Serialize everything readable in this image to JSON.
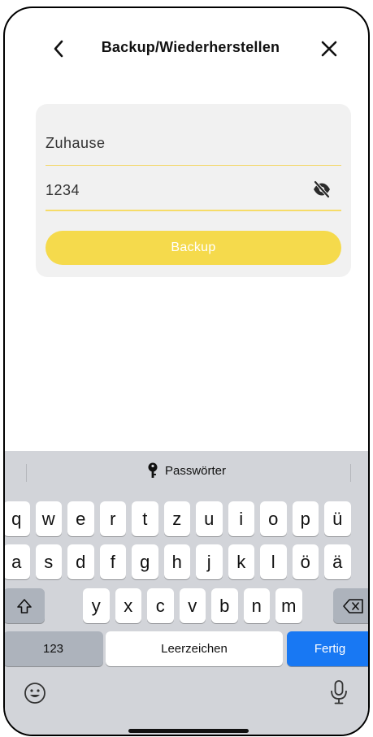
{
  "header": {
    "title": "Backup/Wiederherstellen"
  },
  "form": {
    "name_value": "Zuhause",
    "password_value": "1234",
    "backup_label": "Backup"
  },
  "keyboard": {
    "suggestion": "Passwörter",
    "row1": [
      "q",
      "w",
      "e",
      "r",
      "t",
      "z",
      "u",
      "i",
      "o",
      "p",
      "ü"
    ],
    "row2": [
      "a",
      "s",
      "d",
      "f",
      "g",
      "h",
      "j",
      "k",
      "l",
      "ö",
      "ä"
    ],
    "row3": [
      "y",
      "x",
      "c",
      "v",
      "b",
      "n",
      "m"
    ],
    "numbers_label": "123",
    "space_label": "Leerzeichen",
    "done_label": "Fertig"
  },
  "colors": {
    "accent": "#f5da4c",
    "keyboard_bg": "#d2d4d9",
    "done_blue": "#1878f3"
  },
  "icons": [
    "back-chevron-icon",
    "close-icon",
    "eye-slash-icon",
    "key-icon",
    "shift-icon",
    "delete-icon",
    "emoji-icon",
    "microphone-icon"
  ]
}
